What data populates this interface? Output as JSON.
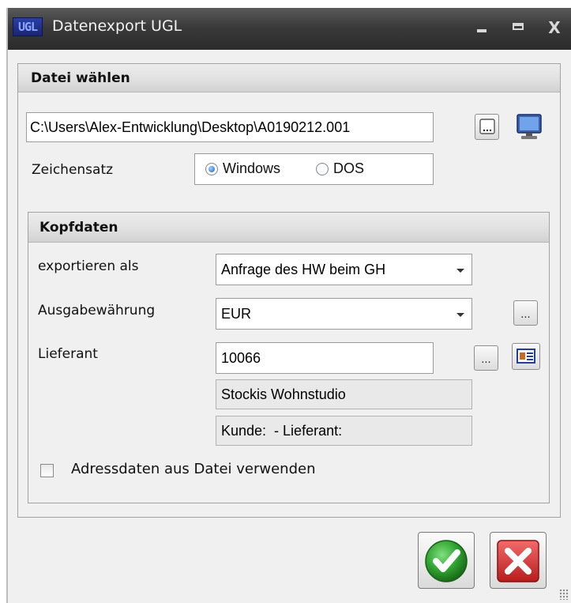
{
  "window": {
    "logo_text": "UGL",
    "title": "Datenexport UGL",
    "min_label": "minimize",
    "max_label": "maximize",
    "close_label": "X"
  },
  "file_section": {
    "header": "Datei wählen",
    "path_value": "C:\\Users\\Alex-Entwicklung\\Desktop\\A0190212.001",
    "charset_label": "Zeichensatz",
    "charset_options": [
      "Windows",
      "DOS"
    ],
    "charset_selected": "Windows",
    "browse_icon": "folder-browse-icon",
    "computer_icon": "computer-icon"
  },
  "head_section": {
    "header": "Kopfdaten",
    "export_as_label": "exportieren als",
    "export_as_value": "Anfrage des HW beim GH",
    "currency_label": "Ausgabewährung",
    "currency_value": "EUR",
    "supplier_label": "Lieferant",
    "supplier_value": "10066",
    "supplier_name": "Stockis Wohnstudio",
    "customer_line": "Kunde:  - Lieferant:",
    "dots_label": "...",
    "address_checkbox_label": "Adressdaten aus Datei verwenden",
    "address_checkbox_checked": false
  },
  "actions": {
    "ok_icon": "green-check-icon",
    "cancel_icon": "red-x-icon"
  },
  "colors": {
    "titlebar": "#333333",
    "ok_green": "#2fa12f",
    "cancel_red": "#d42a2a"
  }
}
